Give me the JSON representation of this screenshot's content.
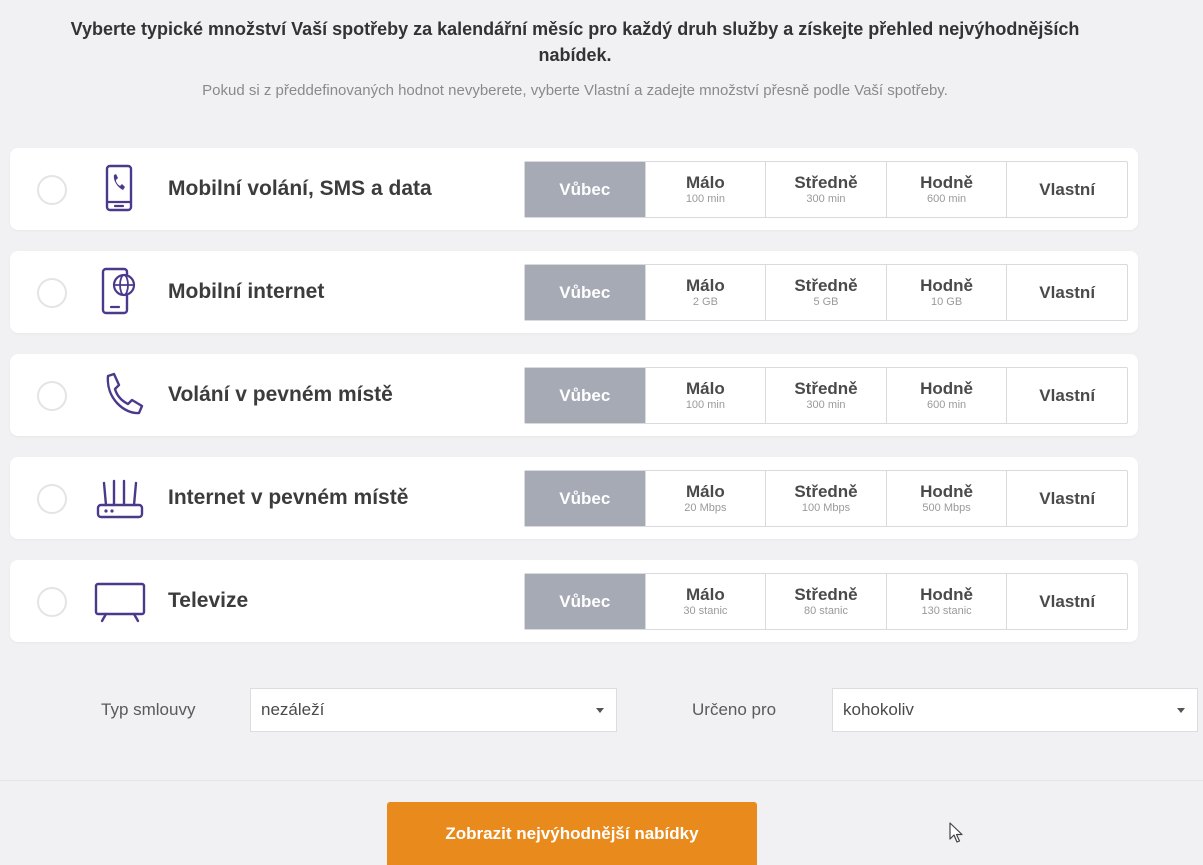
{
  "intro": {
    "title": "Vyberte typické množství Vaší spotřeby za kalendářní měsíc pro každý druh služby a získejte přehled nejvýhodnějších nabídek.",
    "subtitle": "Pokud si z předdefinovaných hodnot nevyberete, vyberte Vlastní a zadejte množství přesně podle Vaší spotřeby."
  },
  "services": [
    {
      "icon": "mobile-phone-call-icon",
      "label": "Mobilní volání, SMS a data",
      "options": [
        {
          "title": "Vůbec",
          "sub": ""
        },
        {
          "title": "Málo",
          "sub": "100 min"
        },
        {
          "title": "Středně",
          "sub": "300 min"
        },
        {
          "title": "Hodně",
          "sub": "600 min"
        },
        {
          "title": "Vlastní",
          "sub": ""
        }
      ],
      "selected": "Vůbec"
    },
    {
      "icon": "mobile-internet-globe-icon",
      "label": "Mobilní internet",
      "options": [
        {
          "title": "Vůbec",
          "sub": ""
        },
        {
          "title": "Málo",
          "sub": "2 GB"
        },
        {
          "title": "Středně",
          "sub": "5 GB"
        },
        {
          "title": "Hodně",
          "sub": "10 GB"
        },
        {
          "title": "Vlastní",
          "sub": ""
        }
      ],
      "selected": "Vůbec"
    },
    {
      "icon": "landline-phone-icon",
      "label": "Volání v pevném místě",
      "options": [
        {
          "title": "Vůbec",
          "sub": ""
        },
        {
          "title": "Málo",
          "sub": "100 min"
        },
        {
          "title": "Středně",
          "sub": "300 min"
        },
        {
          "title": "Hodně",
          "sub": "600 min"
        },
        {
          "title": "Vlastní",
          "sub": ""
        }
      ],
      "selected": "Vůbec"
    },
    {
      "icon": "router-icon",
      "label": "Internet v pevném místě",
      "options": [
        {
          "title": "Vůbec",
          "sub": ""
        },
        {
          "title": "Málo",
          "sub": "20 Mbps"
        },
        {
          "title": "Středně",
          "sub": "100 Mbps"
        },
        {
          "title": "Hodně",
          "sub": "500 Mbps"
        },
        {
          "title": "Vlastní",
          "sub": ""
        }
      ],
      "selected": "Vůbec"
    },
    {
      "icon": "television-icon",
      "label": "Televize",
      "options": [
        {
          "title": "Vůbec",
          "sub": ""
        },
        {
          "title": "Málo",
          "sub": "30 stanic"
        },
        {
          "title": "Středně",
          "sub": "80 stanic"
        },
        {
          "title": "Hodně",
          "sub": "130 stanic"
        },
        {
          "title": "Vlastní",
          "sub": ""
        }
      ],
      "selected": "Vůbec"
    }
  ],
  "filters": {
    "contract_label": "Typ smlouvy",
    "contract_value": "nezáleží",
    "audience_label": "Určeno pro",
    "audience_value": "kohokoliv"
  },
  "cta_label": "Zobrazit nejvýhodnější nabídky",
  "colors": {
    "accent_orange": "#e98a1d",
    "icon_purple": "#4b3a8c",
    "active_option": "#a5aab4",
    "background": "#f1f0f3"
  }
}
